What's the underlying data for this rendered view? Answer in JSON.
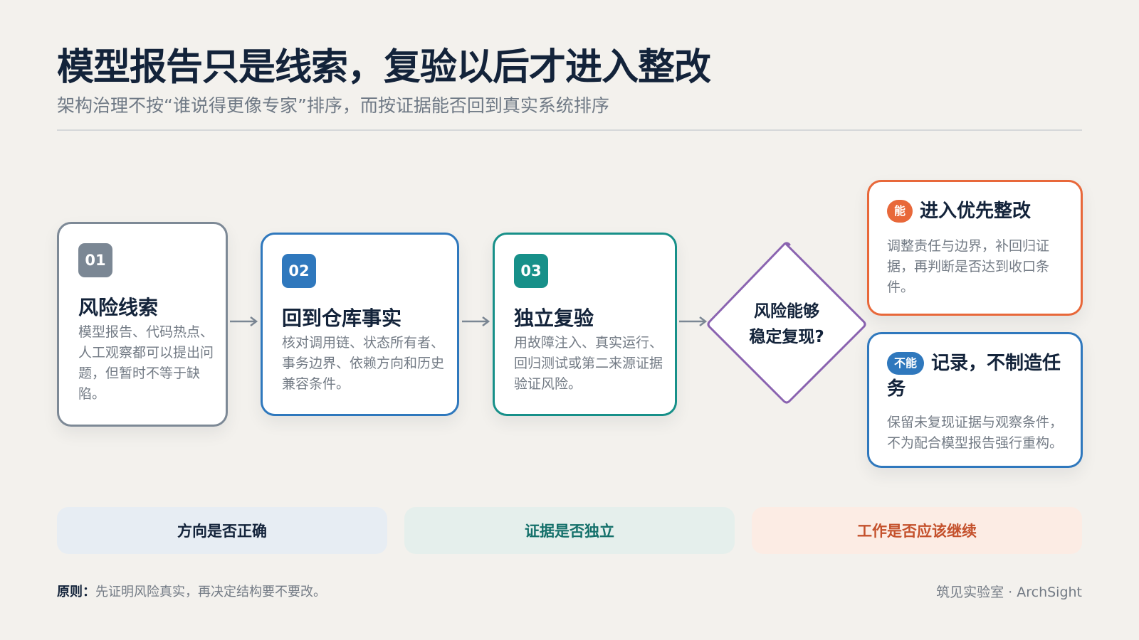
{
  "header": {
    "title": "模型报告只是线索，复验以后才进入整改",
    "subtitle": "架构治理不按“谁说得更像专家”排序，而按证据能否回到真实系统排序"
  },
  "steps": [
    {
      "num": "01",
      "title": "风险线索",
      "desc": "模型报告、代码热点、人工观察都可以提出问题，但暂时不等于缺陷。",
      "color": "#7b8794"
    },
    {
      "num": "02",
      "title": "回到仓库事实",
      "desc": "核对调用链、状态所有者、事务边界、依赖方向和历史兼容条件。",
      "color": "#2f78bd"
    },
    {
      "num": "03",
      "title": "独立复验",
      "desc": "用故障注入、真实运行、回归测试或第二来源证据验证风险。",
      "color": "#179089"
    }
  ],
  "decision": {
    "line1": "风险能够",
    "line2": "稳定复现?",
    "color": "#8a63b0"
  },
  "outcomes": {
    "yes": {
      "badge": "能",
      "title": "进入优先整改",
      "desc": "调整责任与边界，补回归证据，再判断是否达到收口条件。",
      "color": "#e8683a"
    },
    "no": {
      "badge": "不能",
      "title": "记录，不制造任务",
      "desc": "保留未复现证据与观察条件，不为配合模型报告强行重构。",
      "color": "#2f78bd"
    }
  },
  "pills": [
    "方向是否正确",
    "证据是否独立",
    "工作是否应该继续"
  ],
  "footer": {
    "principle_label": "原则：",
    "principle_text": "先证明风险真实，再决定结构要不要改。",
    "brand": "筑见实验室 · ArchSight"
  }
}
